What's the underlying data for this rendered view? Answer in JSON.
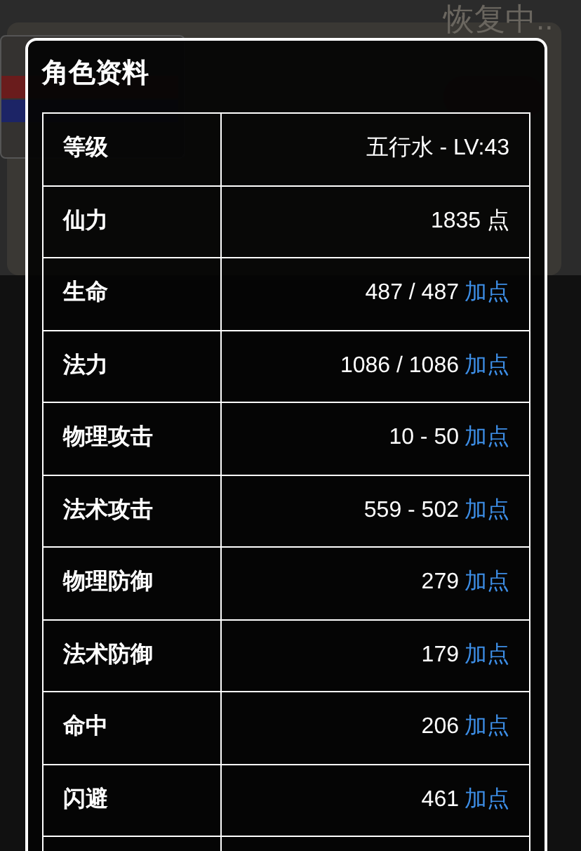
{
  "background": {
    "status": "恢复中.."
  },
  "dialog": {
    "title": "角色资料",
    "rows": [
      {
        "label": "等级",
        "value": "五行水 - LV:43"
      },
      {
        "label": "仙力",
        "value": "1835 点"
      },
      {
        "label": "生命",
        "value": "487 / 487",
        "action": "加点"
      },
      {
        "label": "法力",
        "value": "1086 / 1086",
        "action": "加点"
      },
      {
        "label": "物理攻击",
        "value": "10 - 50",
        "action": "加点"
      },
      {
        "label": "法术攻击",
        "value": "559 - 502",
        "action": "加点"
      },
      {
        "label": "物理防御",
        "value": "279",
        "action": "加点"
      },
      {
        "label": "法术防御",
        "value": "179",
        "action": "加点"
      },
      {
        "label": "命中",
        "value": "206",
        "action": "加点"
      },
      {
        "label": "闪避",
        "value": "461",
        "action": "加点"
      }
    ]
  }
}
